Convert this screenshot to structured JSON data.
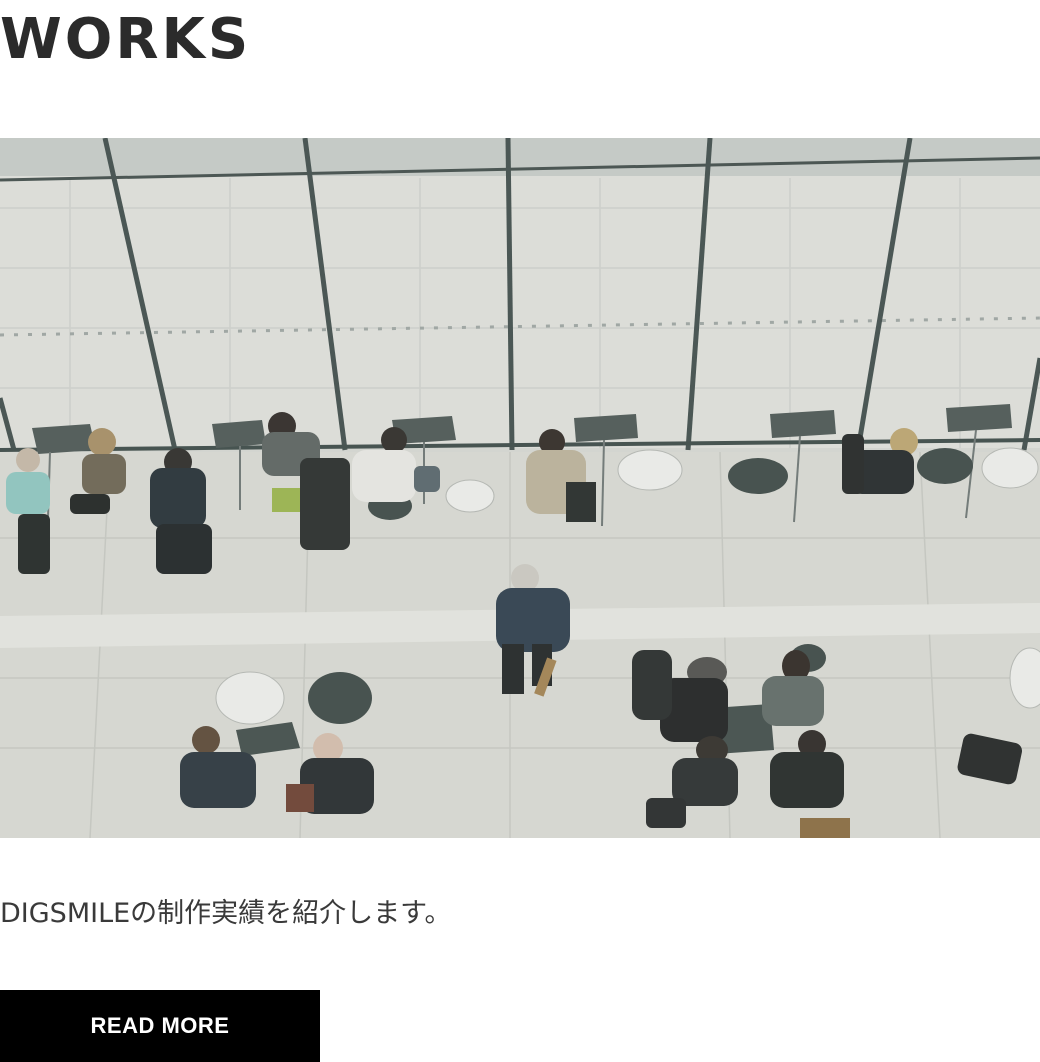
{
  "section": {
    "title": "WORKS",
    "description": "DIGSMILEの制作実績を紹介します。",
    "button_label": "READ MORE"
  },
  "colors": {
    "title": "#2b2b2b",
    "text": "#3a3a3a",
    "button_bg": "#000000",
    "button_text": "#ffffff"
  }
}
